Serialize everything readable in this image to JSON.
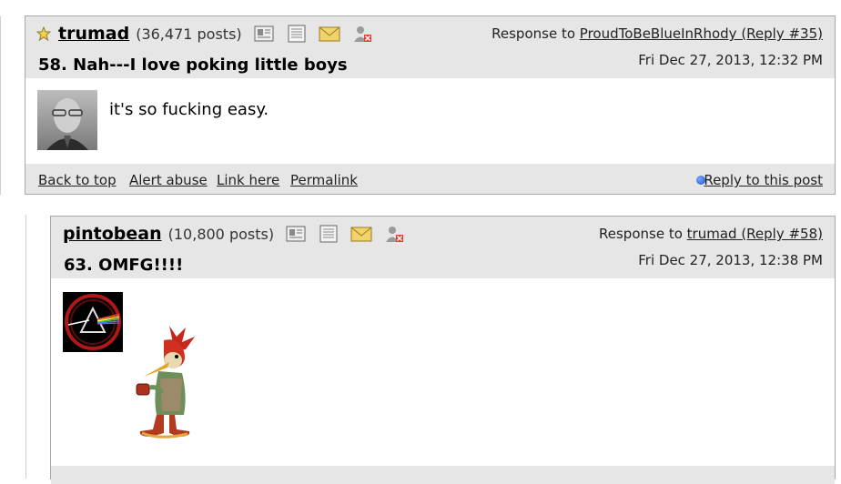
{
  "posts": [
    {
      "author": "trumad",
      "post_count": "(36,471 posts)",
      "response_prefix": "Response to",
      "response_link": "ProudToBeBlueInRhody (Reply #35)",
      "title": "58. Nah---I love poking little boys",
      "date": "Fri Dec 27, 2013, 12:32 PM",
      "body": "it's so fucking easy.",
      "footer": {
        "back_to_top": "Back to top",
        "alert_abuse": "Alert abuse",
        "link_here": "Link here",
        "permalink": "Permalink",
        "reply": "Reply to this post"
      }
    },
    {
      "author": "pintobean",
      "post_count": "(10,800 posts)",
      "response_prefix": "Response to",
      "response_link": "trumad (Reply #58)",
      "title": "63. OMFG!!!!",
      "date": "Fri Dec 27, 2013, 12:38 PM"
    }
  ],
  "icons": [
    "star-icon",
    "profile-card-icon",
    "journal-icon",
    "email-icon",
    "ignore-user-icon",
    "reply-bullet-icon"
  ],
  "colors": {
    "header_bg": "#e6e6e6",
    "border": "#a8a8a8",
    "reply_dot": "#1d4fd6"
  }
}
